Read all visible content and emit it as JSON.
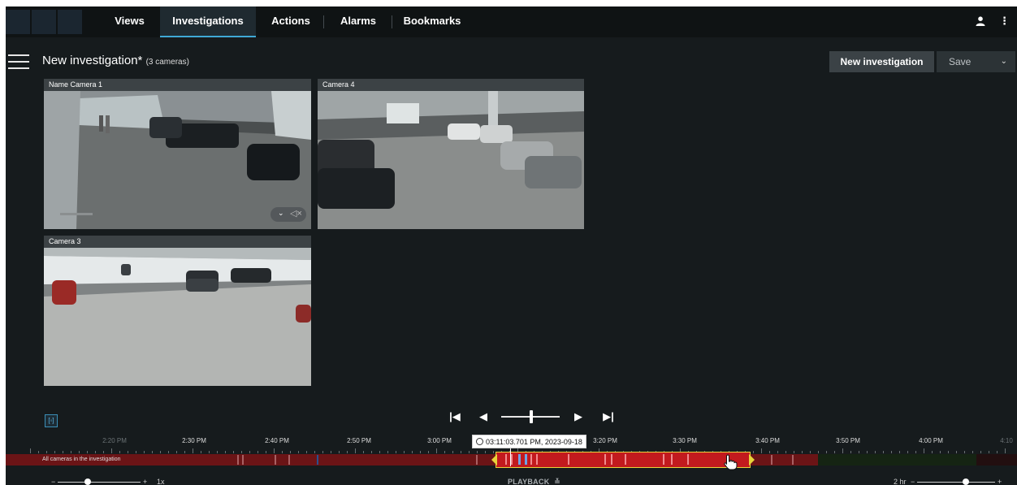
{
  "nav": {
    "tabs": [
      {
        "label": "Views"
      },
      {
        "label": "Investigations",
        "active": true
      },
      {
        "label": "Actions"
      },
      {
        "label": "Alarms"
      },
      {
        "label": "Bookmarks"
      }
    ],
    "user_icon": "user-icon",
    "more_icon": "kebab-icon",
    "accent_color": "#3fa9d6"
  },
  "title_bar": {
    "title": "New investigation*",
    "subtitle": "(3 cameras)",
    "new_investigation_label": "New investigation",
    "save_label": "Save",
    "save_chevron": "⌄"
  },
  "cameras": [
    {
      "name": "Name Camera 1"
    },
    {
      "name": "Camera 4"
    },
    {
      "name": "Camera 3"
    }
  ],
  "camera_controls": {
    "chevron": "⌄",
    "mute": "◁×"
  },
  "playback": {
    "skip_start": "|◀",
    "step_back": "◀",
    "step_forward": "▶",
    "skip_end": "▶|",
    "selection_icon": "[◦]"
  },
  "timeline": {
    "labels": [
      "2:20 PM",
      "2:30 PM",
      "2:40 PM",
      "2:50 PM",
      "3:00 PM",
      "3:20 PM",
      "3:30 PM",
      "3:40 PM",
      "3:50 PM",
      "4:00 PM",
      "4:10"
    ],
    "cursor_time": "03:11:03.701 PM, 2023-09-18",
    "track_label": "All cameras in the investigation",
    "colors": {
      "recording": "#6b1416",
      "selected": "#c21a1e",
      "selection_border": "#e8d33a",
      "no_motion": "#152413"
    }
  },
  "bottom": {
    "zoom_minus": "−",
    "zoom_plus": "+",
    "speed": "1x",
    "playback_label": "PLAYBACK",
    "playback_chevron": "≚",
    "range": "2 hr",
    "range_minus": "−",
    "range_plus": "+"
  }
}
